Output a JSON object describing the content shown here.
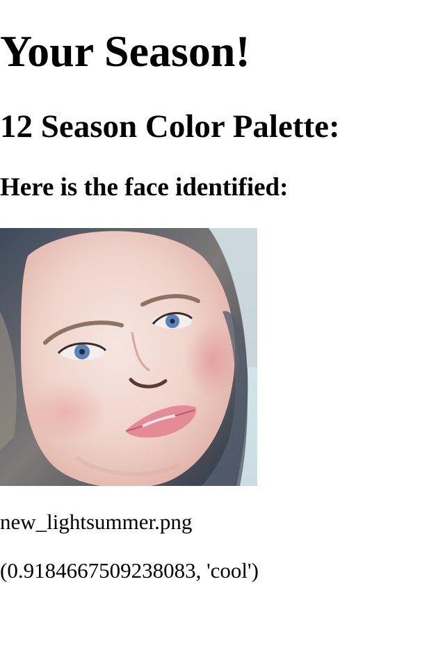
{
  "page": {
    "title": "Your Season!",
    "palette_heading": "12 Season Color Palette:",
    "face_heading": "Here is the face identified:"
  },
  "face_image": {
    "alt": "face identified"
  },
  "result": {
    "filename": "new_lightsummer.png",
    "score_text": "(0.9184667509238083, 'cool')"
  }
}
